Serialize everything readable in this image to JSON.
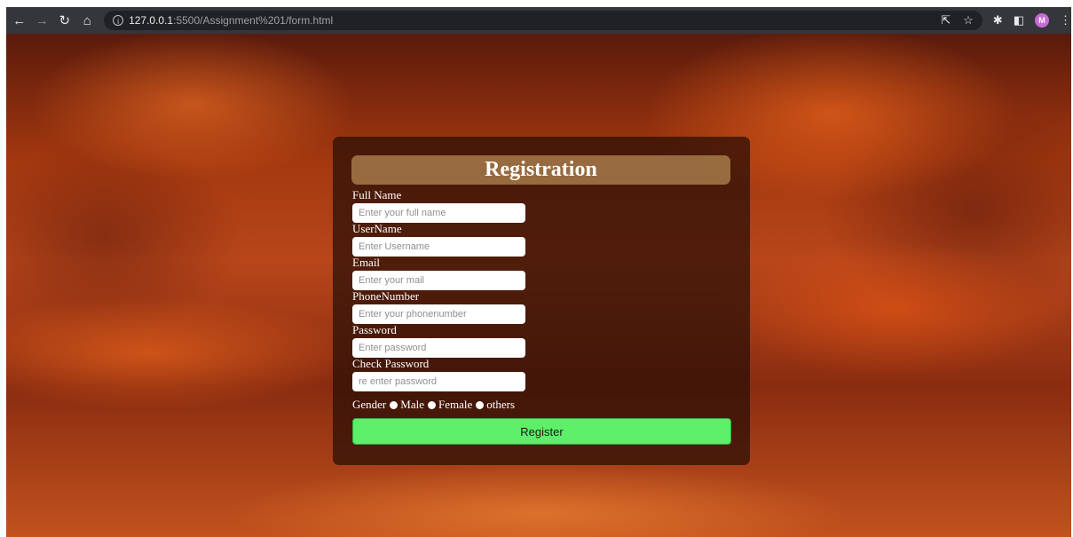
{
  "browser": {
    "url_host": "127.0.0.1",
    "url_path": ":5500/Assignment%201/form.html",
    "profile_initial": "M",
    "profile_color": "#c86bd8"
  },
  "form": {
    "title": "Registration",
    "fields": [
      {
        "label": "Full Name",
        "placeholder": "Enter your full name"
      },
      {
        "label": "UserName",
        "placeholder": "Enter Username"
      },
      {
        "label": "Email",
        "placeholder": "Enter your mail"
      },
      {
        "label": "PhoneNumber",
        "placeholder": "Enter your phonenumber"
      },
      {
        "label": "Password",
        "placeholder": "Enter password"
      },
      {
        "label": "Check Password",
        "placeholder": "re enter password"
      }
    ],
    "gender_label": "Gender",
    "gender_options": [
      "Male",
      "Female",
      "others"
    ],
    "submit_label": "Register",
    "submit_color": "#5cf06a"
  }
}
